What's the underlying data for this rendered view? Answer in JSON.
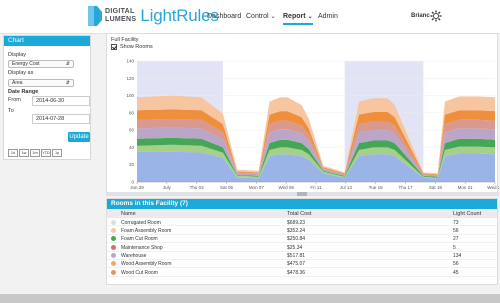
{
  "header": {
    "logo_line1": "DIGITAL",
    "logo_line2": "LUMENS",
    "app_name": "LightRules",
    "nav": [
      {
        "label": "Dashboard",
        "has_caret": false,
        "active": false
      },
      {
        "label": "Control",
        "has_caret": true,
        "active": false
      },
      {
        "label": "Report",
        "has_caret": true,
        "active": true
      },
      {
        "label": "Admin",
        "has_caret": false,
        "active": false
      }
    ],
    "user": "Brianc",
    "settings_icon": "gear-icon",
    "accent": "#1aa9d9"
  },
  "sidebar": {
    "title": "Chart",
    "display_label": "Display",
    "display_value": "Energy Cost",
    "display_as_label": "Display as",
    "display_as_value": "Area",
    "date_range_label": "Date Range",
    "from_label": "From",
    "from_value": "2014-06-30",
    "to_label": "To",
    "to_value": "2014-07-28",
    "update_button": "Update",
    "zoom_buttons": [
      "1d",
      "1w",
      "1m",
      "YTD",
      "1y"
    ]
  },
  "chart_panel": {
    "title": "Full Facility",
    "show_rooms_label": "Show Rooms",
    "show_rooms_checked": true
  },
  "chart_data": {
    "type": "area",
    "stacked": true,
    "ylim": [
      0,
      140
    ],
    "yticks": [
      "0",
      "20",
      "40",
      "60",
      "80",
      "100",
      "120",
      "140"
    ],
    "xticks": [
      "Jun 29",
      "July",
      "Thu 03",
      "Sat 05",
      "Mon 07",
      "Wed 09",
      "Fri 11",
      "Jul 13",
      "Tue 15",
      "Thu 17",
      "Sat 19",
      "Mon 21",
      "Wed 23"
    ],
    "x": [
      0,
      10,
      18,
      24,
      28,
      30,
      34,
      37,
      40,
      42,
      46,
      48,
      52,
      58,
      62,
      66,
      70,
      72,
      80,
      84,
      86,
      90,
      95,
      100
    ],
    "series": [
      {
        "color": "#9ab4e8",
        "values": [
          35,
          35,
          34,
          28,
          5,
          5,
          4,
          30,
          32,
          32,
          30,
          26,
          10,
          5,
          30,
          32,
          32,
          30,
          5,
          4,
          30,
          33,
          33,
          32
        ]
      },
      {
        "color": "#a6d08a",
        "values": [
          7,
          8,
          8,
          6,
          2,
          2,
          2,
          7,
          8,
          8,
          7,
          6,
          2,
          1,
          7,
          8,
          8,
          7,
          1,
          1,
          7,
          8,
          8,
          8
        ]
      },
      {
        "color": "#43a756",
        "values": [
          8,
          8,
          8,
          6,
          1,
          1,
          1,
          8,
          9,
          9,
          8,
          6,
          1,
          1,
          8,
          8,
          8,
          8,
          1,
          1,
          8,
          9,
          9,
          9
        ]
      },
      {
        "color": "#bca6c8",
        "values": [
          12,
          12,
          12,
          10,
          2,
          2,
          2,
          12,
          12,
          12,
          11,
          9,
          2,
          1,
          12,
          12,
          12,
          11,
          1,
          1,
          12,
          12,
          12,
          12
        ]
      },
      {
        "color": "#d89a8f",
        "values": [
          10,
          10,
          10,
          8,
          1,
          1,
          1,
          10,
          10,
          10,
          9,
          7,
          1,
          1,
          10,
          10,
          10,
          9,
          1,
          1,
          10,
          10,
          10,
          10
        ]
      },
      {
        "color": "#ef8f3e",
        "values": [
          11,
          11,
          11,
          9,
          1,
          1,
          1,
          11,
          11,
          11,
          10,
          8,
          1,
          1,
          11,
          11,
          11,
          10,
          1,
          1,
          11,
          11,
          11,
          11
        ]
      },
      {
        "color": "#f7c6a0",
        "values": [
          15,
          16,
          15,
          12,
          2,
          2,
          2,
          15,
          16,
          16,
          14,
          11,
          2,
          1,
          15,
          16,
          16,
          14,
          1,
          1,
          15,
          16,
          16,
          16
        ]
      }
    ]
  },
  "table": {
    "title": "Rooms in this Facility (7)",
    "columns": [
      "Name",
      "Total Cost",
      "Light Count"
    ],
    "rows": [
      {
        "color": "#dcdcdc",
        "name": "Corrugated Room",
        "cost": "$689.23",
        "count": "73"
      },
      {
        "color": "#f3c9a4",
        "name": "Foam Assembly Room",
        "cost": "$352.24",
        "count": "56"
      },
      {
        "color": "#3fae52",
        "name": "Foam Cut Room",
        "cost": "$250.84",
        "count": "27"
      },
      {
        "color": "#e06a6a",
        "name": "Maintenance Shop",
        "cost": "$25.34",
        "count": "5"
      },
      {
        "color": "#b9a7cf",
        "name": "Warehouse",
        "cost": "$517.81",
        "count": "134"
      },
      {
        "color": "#f0a96c",
        "name": "Wood Assembly Room",
        "cost": "$475.07",
        "count": "56"
      },
      {
        "color": "#d99966",
        "name": "Wood Cut Room",
        "cost": "$478.36",
        "count": "45"
      }
    ]
  }
}
